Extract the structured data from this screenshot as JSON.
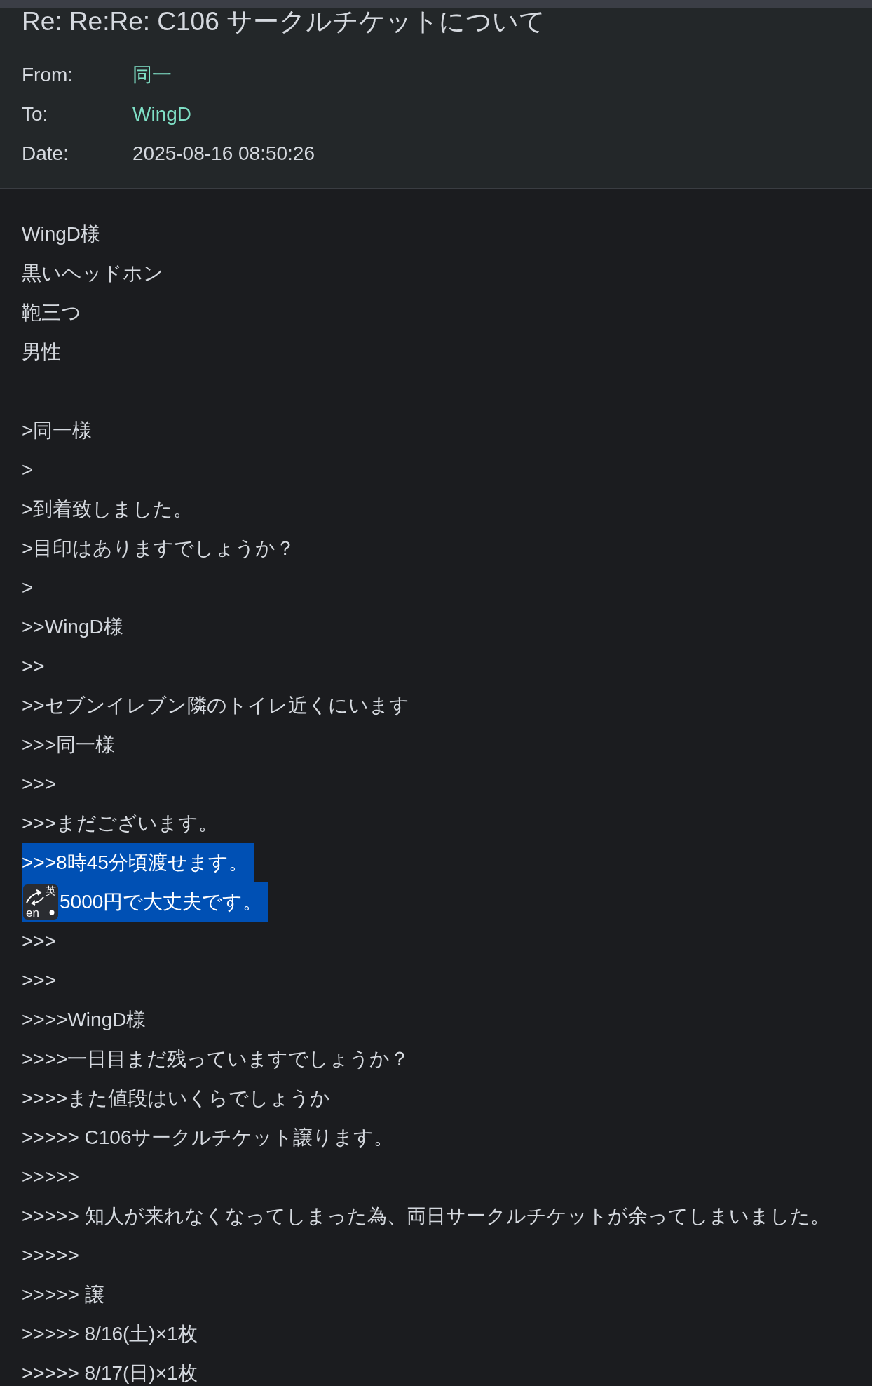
{
  "message": {
    "subject": "Re: Re:Re: C106 サークルチケットについて",
    "headers": [
      {
        "label": "From:",
        "value": "同一",
        "kind": "contact"
      },
      {
        "label": "To:",
        "value": "WingD",
        "kind": "contact"
      },
      {
        "label": "Date:",
        "value": "2025-08-16 08:50:26",
        "kind": "plain"
      }
    ],
    "body_lines": [
      {
        "kind": "text",
        "text": "WingD様"
      },
      {
        "kind": "text",
        "text": "黒いヘッドホン"
      },
      {
        "kind": "text",
        "text": "鞄三つ"
      },
      {
        "kind": "text",
        "text": "男性"
      },
      {
        "kind": "blank"
      },
      {
        "kind": "text",
        "text": ">同一様"
      },
      {
        "kind": "text",
        "text": ">"
      },
      {
        "kind": "text",
        "text": ">到着致しました。"
      },
      {
        "kind": "text",
        "text": ">目印はありますでしょうか？"
      },
      {
        "kind": "text",
        "text": ">"
      },
      {
        "kind": "text",
        "text": ">>WingD様"
      },
      {
        "kind": "text",
        "text": ">>"
      },
      {
        "kind": "text",
        "text": ">>セブンイレブン隣のトイレ近くにいます"
      },
      {
        "kind": "text",
        "text": ">>>同一様"
      },
      {
        "kind": "text",
        "text": ">>>"
      },
      {
        "kind": "text",
        "text": ">>>まだございます。"
      },
      {
        "kind": "text",
        "text": ">>>8時45分頃渡せます。",
        "selected": true
      },
      {
        "kind": "text",
        "text": "5000円で大丈夫です。",
        "selected": true,
        "ime_indicator": {
          "top": "英",
          "bottom": "en"
        }
      },
      {
        "kind": "text",
        "text": ">>>"
      },
      {
        "kind": "text",
        "text": ">>>"
      },
      {
        "kind": "text",
        "text": ">>>>WingD様"
      },
      {
        "kind": "text",
        "text": ">>>>一日目まだ残っていますでしょうか？"
      },
      {
        "kind": "text",
        "text": ">>>>また値段はいくらでしょうか"
      },
      {
        "kind": "text",
        "text": ">>>>> C106サークルチケット譲ります。"
      },
      {
        "kind": "text",
        "text": ">>>>>"
      },
      {
        "kind": "text",
        "text": ">>>>> 知人が来れなくなってしまった為、両日サークルチケットが余ってしまいました。"
      },
      {
        "kind": "text",
        "text": ">>>>>"
      },
      {
        "kind": "text",
        "text": ">>>>> 譲"
      },
      {
        "kind": "text",
        "text": ">>>>> 8/16(土)×1枚"
      },
      {
        "kind": "text",
        "text": ">>>>> 8/17(日)×1枚"
      }
    ]
  }
}
